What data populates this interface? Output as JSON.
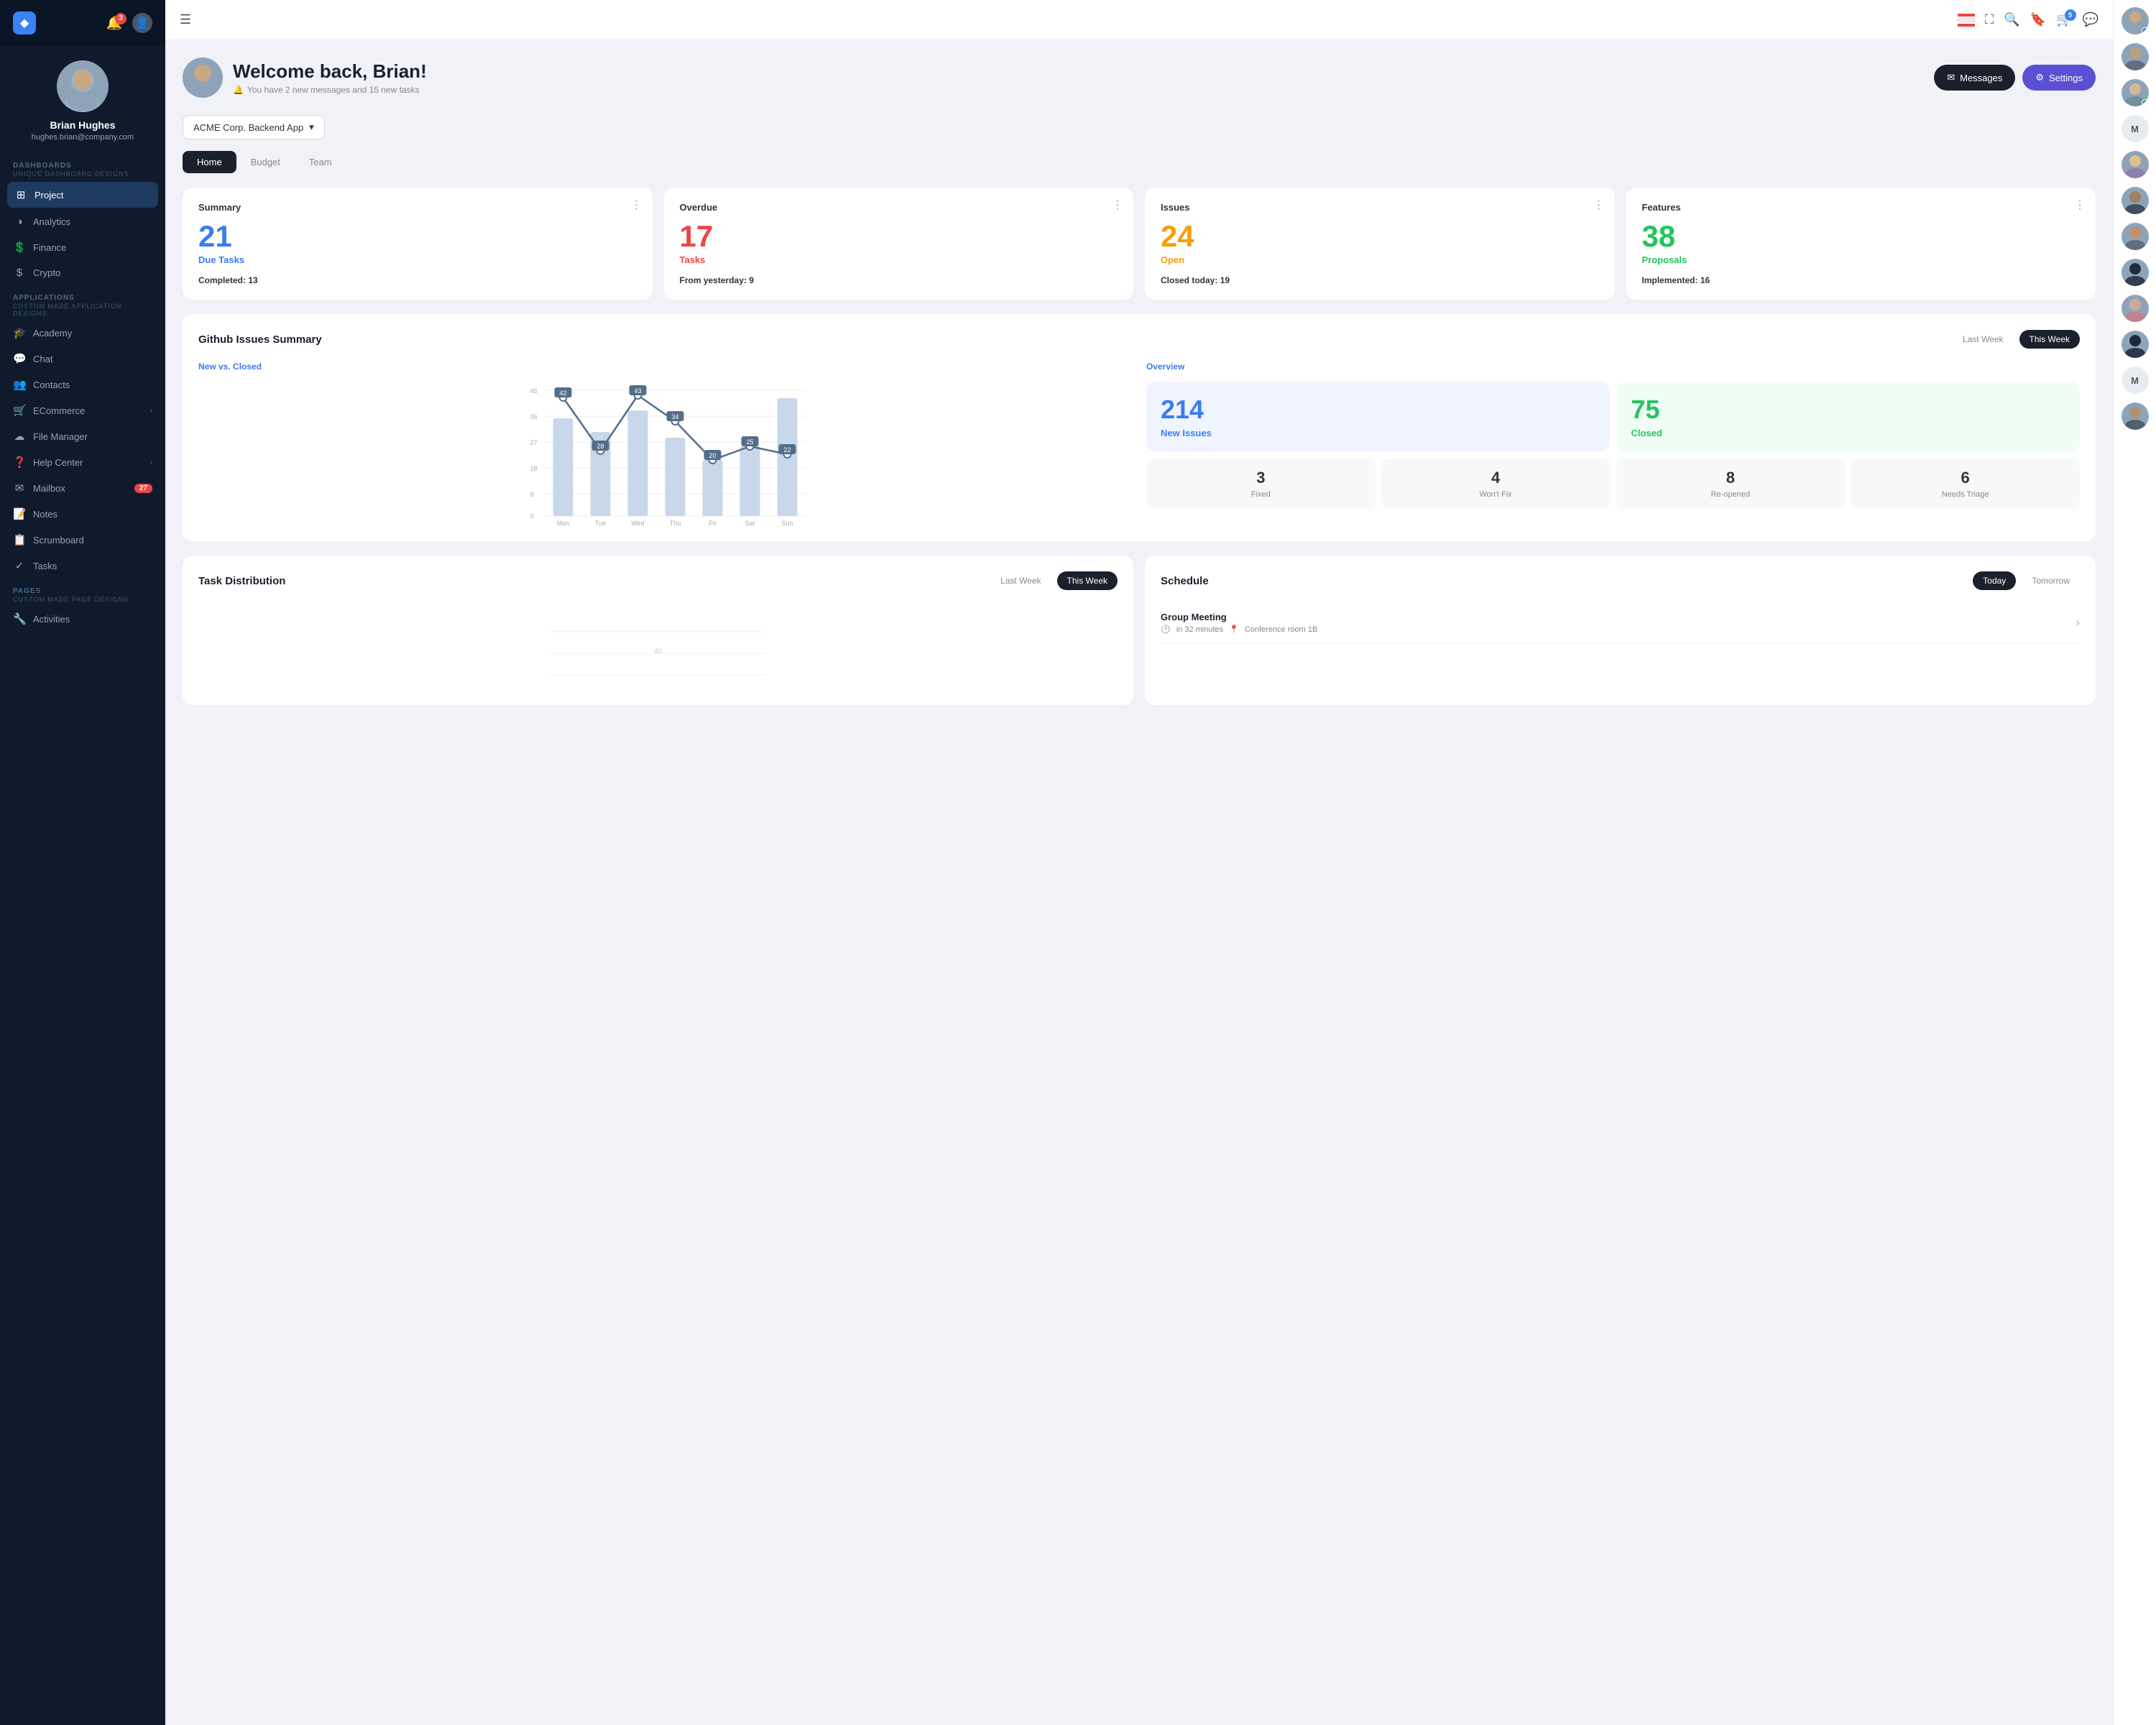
{
  "app": {
    "logo": "◆",
    "notification_count": "3"
  },
  "profile": {
    "name": "Brian Hughes",
    "email": "hughes.brian@company.com",
    "avatar_text": "👤"
  },
  "sidebar": {
    "sections": [
      {
        "label": "DASHBOARDS",
        "sublabel": "Unique dashboard designs",
        "items": [
          {
            "icon": "⊞",
            "label": "Project",
            "active": true
          },
          {
            "icon": "◑",
            "label": "Analytics"
          },
          {
            "icon": "💲",
            "label": "Finance"
          },
          {
            "icon": "$",
            "label": "Crypto"
          }
        ]
      },
      {
        "label": "APPLICATIONS",
        "sublabel": "Custom made application designs",
        "items": [
          {
            "icon": "🎓",
            "label": "Academy"
          },
          {
            "icon": "💬",
            "label": "Chat"
          },
          {
            "icon": "👥",
            "label": "Contacts"
          },
          {
            "icon": "🛒",
            "label": "ECommerce",
            "has_chevron": true
          },
          {
            "icon": "☁",
            "label": "File Manager"
          },
          {
            "icon": "❓",
            "label": "Help Center",
            "has_chevron": true
          },
          {
            "icon": "✉",
            "label": "Mailbox",
            "badge": "27"
          },
          {
            "icon": "📝",
            "label": "Notes"
          },
          {
            "icon": "📋",
            "label": "Scrumboard"
          },
          {
            "icon": "✓",
            "label": "Tasks"
          }
        ]
      },
      {
        "label": "PAGES",
        "sublabel": "Custom made page designs",
        "items": [
          {
            "icon": "🔧",
            "label": "Activities"
          }
        ]
      }
    ]
  },
  "welcome": {
    "greeting": "Welcome back, Brian!",
    "subtitle": "You have 2 new messages and 15 new tasks",
    "messages_btn": "Messages",
    "settings_btn": "Settings"
  },
  "project_selector": {
    "label": "ACME Corp. Backend App"
  },
  "tabs": [
    {
      "label": "Home",
      "active": true
    },
    {
      "label": "Budget",
      "active": false
    },
    {
      "label": "Team",
      "active": false
    }
  ],
  "stat_cards": [
    {
      "title": "Summary",
      "number": "21",
      "number_color": "blue",
      "label": "Due Tasks",
      "label_color": "blue",
      "footer_text": "Completed:",
      "footer_value": "13"
    },
    {
      "title": "Overdue",
      "number": "17",
      "number_color": "red",
      "label": "Tasks",
      "label_color": "red",
      "footer_text": "From yesterday:",
      "footer_value": "9"
    },
    {
      "title": "Issues",
      "number": "24",
      "number_color": "orange",
      "label": "Open",
      "label_color": "orange",
      "footer_text": "Closed today:",
      "footer_value": "19"
    },
    {
      "title": "Features",
      "number": "38",
      "number_color": "green",
      "label": "Proposals",
      "label_color": "green",
      "footer_text": "Implemented:",
      "footer_value": "16"
    }
  ],
  "github": {
    "title": "Github Issues Summary",
    "last_week_btn": "Last Week",
    "this_week_btn": "This Week",
    "chart": {
      "label": "New vs. Closed",
      "days": [
        "Mon",
        "Tue",
        "Wed",
        "Thu",
        "Fri",
        "Sat",
        "Sun"
      ],
      "line_values": [
        42,
        28,
        43,
        34,
        20,
        25,
        22
      ],
      "bar_values": [
        35,
        30,
        38,
        28,
        20,
        25,
        42
      ]
    },
    "overview": {
      "label": "Overview",
      "new_issues": "214",
      "new_issues_label": "New Issues",
      "closed": "75",
      "closed_label": "Closed",
      "mini_stats": [
        {
          "value": "3",
          "label": "Fixed"
        },
        {
          "value": "4",
          "label": "Won't Fix"
        },
        {
          "value": "8",
          "label": "Re-opened"
        },
        {
          "value": "6",
          "label": "Needs Triage"
        }
      ]
    }
  },
  "task_distribution": {
    "title": "Task Distribution",
    "last_week_btn": "Last Week",
    "this_week_btn": "This Week"
  },
  "schedule": {
    "title": "Schedule",
    "today_btn": "Today",
    "tomorrow_btn": "Tomorrow",
    "items": [
      {
        "title": "Group Meeting",
        "time": "in 32 minutes",
        "location": "Conference room 1B"
      }
    ]
  }
}
